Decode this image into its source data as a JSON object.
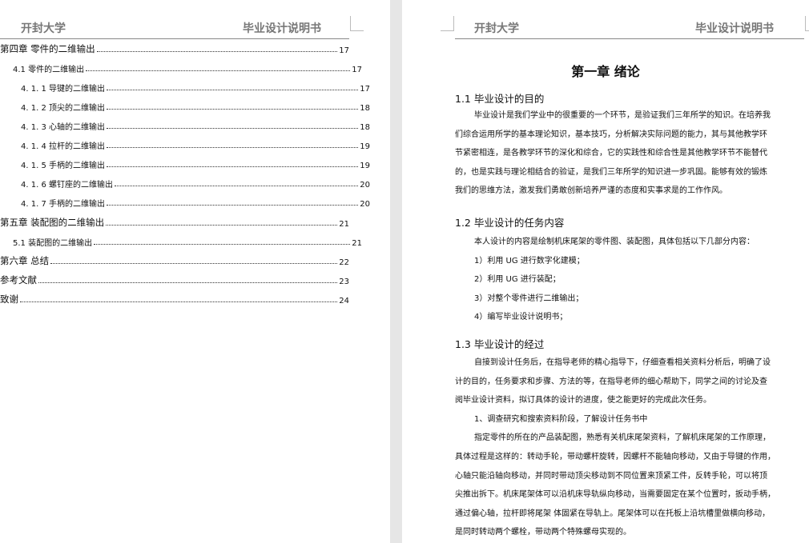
{
  "left_page": {
    "header": {
      "left": "开封大学",
      "right": "毕业设计说明书"
    },
    "toc": [
      {
        "title": "第四章  零件的二维输出",
        "page": "17",
        "level": 1
      },
      {
        "title": "4.1 零件的二维输出",
        "page": "17",
        "level": 2
      },
      {
        "title": "4. 1. 1 导键的二维输出",
        "page": "17",
        "level": 3
      },
      {
        "title": "4. 1. 2 顶尖的二维输出",
        "page": "18",
        "level": 3
      },
      {
        "title": "4. 1. 3 心轴的二维输出",
        "page": "18",
        "level": 3
      },
      {
        "title": "4. 1. 4 拉杆的二维输出",
        "page": "19",
        "level": 3
      },
      {
        "title": "4. 1. 5 手柄的二维输出",
        "page": "19",
        "level": 3
      },
      {
        "title": "4. 1. 6 螺钉座的二维输出",
        "page": "20",
        "level": 3
      },
      {
        "title": "4. 1. 7 手柄的二维输出",
        "page": "20",
        "level": 3
      },
      {
        "title": "第五章  装配图的二维输出",
        "page": "21",
        "level": 1
      },
      {
        "title": "5.1 装配图的二维输出",
        "page": "21",
        "level": 2
      },
      {
        "title": "第六章  总结",
        "page": "22",
        "level": 1
      },
      {
        "title": "参考文献",
        "page": "23",
        "level": 1
      },
      {
        "title": "致谢",
        "page": "24",
        "level": 1
      }
    ]
  },
  "right_page": {
    "header": {
      "left": "开封大学",
      "right": "毕业设计说明书"
    },
    "chapter_title": "第一章  绪论",
    "sections": [
      {
        "heading": "1.1 毕业设计的目的",
        "lines": [
          "毕业设计是我们学业中的很重要的一个环节，是验证我们三年所学的知识。在培养我",
          "们综合运用所学的基本理论知识，基本技巧，分析解决实际问题的能力，其与其他教学环",
          "节紧密相连，是各教学环节的深化和综合，它的实践性和综合性是其他教学环节不能替代",
          "的，也是实践与理论相结合的验证，是我们三年所学的知识进一步巩固。能够有效的锻炼",
          "我们的思维方法，激发我们勇敢创新培养严谨的态度和实事求是的工作作风。"
        ]
      },
      {
        "heading": "1.2 毕业设计的任务内容",
        "lines": [
          "本人设计的内容是绘制机床尾架的零件图、装配图，具体包括以下几部分内容：",
          "1）利用 UG 进行数字化建模；",
          "2）利用 UG 进行装配；",
          "3）对整个零件进行二维输出；",
          "4）编写毕业设计说明书；"
        ]
      },
      {
        "heading": "1.3 毕业设计的经过",
        "lines": [
          "自接到设计任务后，在指导老师的精心指导下，仔细查看相关资料分析后，明确了设",
          "计的目的，任务要求和步骤、方法的等，在指导老师的细心帮助下，同学之间的讨论及查",
          "阅毕业设计资料，拟订具体的设计的进度，使之能更好的完成此次任务。",
          "1、调查研究和搜索资料阶段，了解设计任务书中",
          "指定零件的所在的产品装配图，熟悉有关机床尾架资料，了解机床尾架的工作原理，",
          "具体过程是这样的：转动手轮，带动螺杆旋转，因螺杆不能轴向移动，又由于导键的作用，",
          "心轴只能沿轴向移动，并同时带动顶尖移动到不同位置来顶紧工件，反转手轮，可以将顶",
          "尖推出拆下。机床尾架体可以沿机床导轨纵向移动，当需要固定在某个位置时，扳动手柄，",
          "通过偏心轴，拉杆即将尾架 体固紧在导轨上。尾架体可以在托板上沿坑槽里做横向移动，",
          "是同时转动两个螺栓，带动两个特殊螺母实现的。"
        ]
      }
    ]
  }
}
